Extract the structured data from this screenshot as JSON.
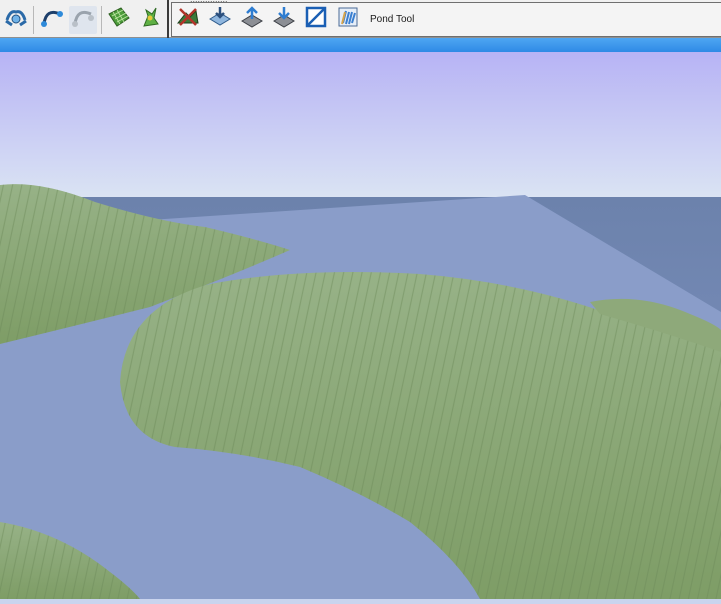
{
  "toolbar": {
    "top_cut_text": "...............",
    "left_tools": [
      {
        "icon": "brush-icon"
      },
      {
        "icon": "curve-tool-icon"
      },
      {
        "icon": "curve-ghost-icon"
      },
      {
        "icon": "terrain-grid-icon"
      },
      {
        "icon": "plant-paint-icon"
      }
    ],
    "right_tools": [
      {
        "icon": "landscape-bulldoze-icon"
      },
      {
        "icon": "road-flatten-icon"
      },
      {
        "icon": "raise-terrain-icon"
      },
      {
        "icon": "lower-terrain-icon"
      },
      {
        "icon": "select-region-icon"
      },
      {
        "icon": "water-paint-icon"
      }
    ],
    "pond_tool_label": "Pond Tool"
  },
  "colors": {
    "sky_top": "#b9b5f6",
    "sky_horizon": "#d9e4f4",
    "water": "#7f93c1",
    "land": "#8aa876",
    "status_bar": "#3d97ee"
  }
}
